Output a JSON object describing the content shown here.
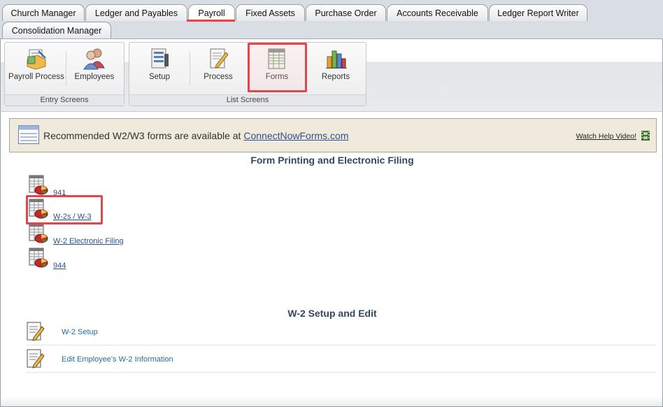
{
  "tabs": {
    "row1": [
      "Church Manager",
      "Ledger and Payables",
      "Payroll",
      "Fixed Assets",
      "Purchase Order",
      "Accounts Receivable",
      "Ledger Report Writer"
    ],
    "row2": [
      "Consolidation Manager"
    ],
    "active": "Payroll"
  },
  "ribbon": {
    "entry_screens": {
      "label": "Entry Screens",
      "buttons": [
        {
          "label": "Payroll Process",
          "icon": "payroll-process-icon"
        },
        {
          "label": "Employees",
          "icon": "employees-icon"
        }
      ]
    },
    "list_screens": {
      "label": "List Screens",
      "buttons": [
        {
          "label": "Setup",
          "icon": "setup-icon"
        },
        {
          "label": "Process",
          "icon": "process-icon"
        },
        {
          "label": "Forms",
          "icon": "forms-icon"
        },
        {
          "label": "Reports",
          "icon": "reports-icon"
        }
      ],
      "selected": "Forms"
    }
  },
  "notice": {
    "text": "Recommended W2/W3 forms are available at ",
    "link": "ConnectNowForms.com",
    "help_link": "Watch Help Video!"
  },
  "forms_section": {
    "title": "Form Printing and Electronic Filing",
    "items": [
      "941",
      "W-2s / W-3",
      "W-2 Electronic Filing",
      "944"
    ]
  },
  "w2_section": {
    "title": "W-2 Setup and Edit",
    "items": [
      "W-2 Setup",
      "Edit Employee's W-2 Information"
    ]
  },
  "colors": {
    "highlight": "#e4454a",
    "link": "#2d4f8f",
    "notice_bg": "#efeadc",
    "section_title": "#35475d"
  }
}
